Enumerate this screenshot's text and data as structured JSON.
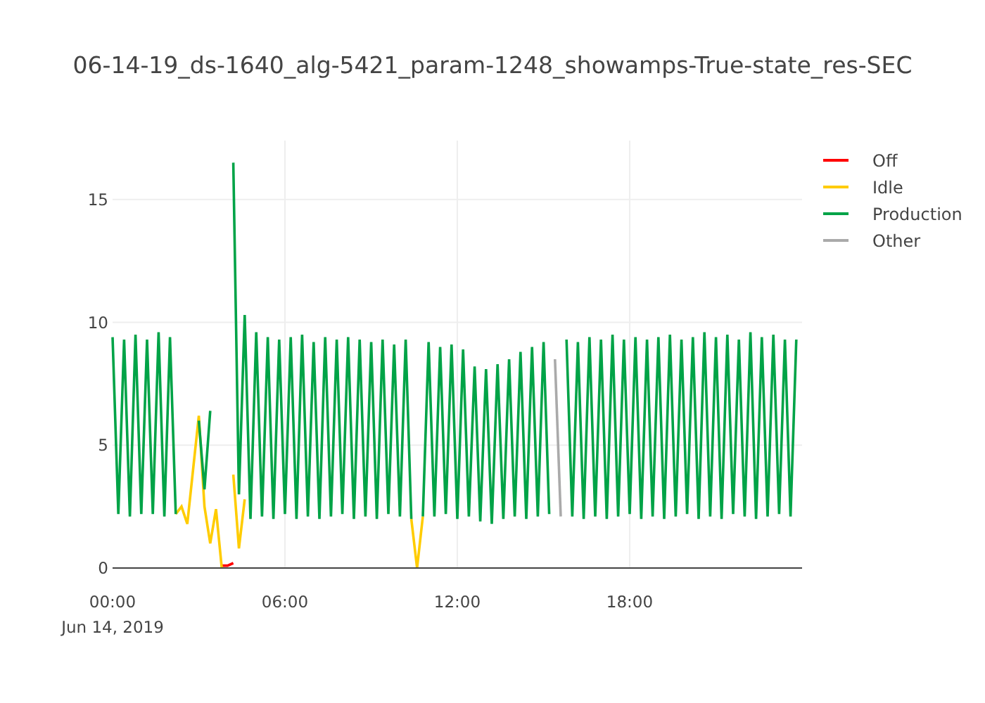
{
  "plot": {
    "title": "06-14-19_ds-1640_alg-5421_param-1248_showamps-True-state_res-SEC",
    "date_label": "Jun 14, 2019",
    "chart_data": {
      "type": "line",
      "grid": true,
      "legend": true,
      "xlim": [
        0,
        24
      ],
      "ylim": [
        0,
        17.4
      ],
      "xticks": [
        {
          "value": 0,
          "label": "00:00"
        },
        {
          "value": 6,
          "label": "06:00"
        },
        {
          "value": 12,
          "label": "12:00"
        },
        {
          "value": 18,
          "label": "18:00"
        }
      ],
      "yticks": [
        0,
        5,
        10,
        15
      ],
      "x": [
        0,
        0.2,
        0.4,
        0.6,
        0.8,
        1.0,
        1.2,
        1.4,
        1.6,
        1.8,
        2.0,
        2.2,
        2.4,
        2.6,
        2.8,
        3.0,
        3.2,
        3.4,
        3.6,
        3.8,
        4.0,
        4.2,
        4.4,
        4.6,
        4.8,
        5.0,
        5.2,
        5.4,
        5.6,
        5.8,
        6.0,
        6.2,
        6.4,
        6.6,
        6.8,
        7.0,
        7.2,
        7.4,
        7.6,
        7.8,
        8.0,
        8.2,
        8.4,
        8.6,
        8.8,
        9.0,
        9.2,
        9.4,
        9.6,
        9.8,
        10.0,
        10.2,
        10.4,
        10.6,
        10.8,
        11.0,
        11.2,
        11.4,
        11.6,
        11.8,
        12.0,
        12.2,
        12.4,
        12.6,
        12.8,
        13.0,
        13.2,
        13.4,
        13.6,
        13.8,
        14.0,
        14.2,
        14.4,
        14.6,
        14.8,
        15.0,
        15.2,
        15.4,
        15.6,
        15.8,
        16.0,
        16.2,
        16.4,
        16.6,
        16.8,
        17.0,
        17.2,
        17.4,
        17.6,
        17.8,
        18.0,
        18.2,
        18.4,
        18.6,
        18.8,
        19.0,
        19.2,
        19.4,
        19.6,
        19.8,
        20.0,
        20.2,
        20.4,
        20.6,
        20.8,
        21.0,
        21.2,
        21.4,
        21.6,
        21.8,
        22.0,
        22.2,
        22.4,
        22.6,
        22.8,
        23.0,
        23.2,
        23.4,
        23.6,
        23.8
      ],
      "series": [
        {
          "name": "Off",
          "color": "#ff0000",
          "values": [
            null,
            null,
            null,
            null,
            null,
            null,
            null,
            null,
            null,
            null,
            null,
            null,
            null,
            null,
            null,
            null,
            null,
            null,
            null,
            0.1,
            0.1,
            0.2,
            null,
            null,
            null,
            null,
            null,
            null,
            null,
            null,
            null,
            null,
            null,
            null,
            null,
            null,
            null,
            null,
            null,
            null,
            null,
            null,
            null,
            null,
            null,
            null,
            null,
            null,
            null,
            null,
            null,
            null,
            null,
            null,
            null,
            null,
            null,
            null,
            null,
            null,
            null,
            null,
            null,
            null,
            null,
            null,
            null,
            null,
            null,
            null,
            null,
            null,
            null,
            null,
            null,
            null,
            null,
            null,
            null,
            null,
            null,
            null,
            null,
            null,
            null,
            null,
            null,
            null,
            null,
            null,
            null,
            null,
            null,
            null,
            null,
            null,
            null,
            null,
            null,
            null,
            null,
            null,
            null,
            null,
            null,
            null,
            null,
            null,
            null,
            null,
            null,
            null,
            null,
            null,
            null,
            null,
            null,
            null,
            null,
            null
          ]
        },
        {
          "name": "Idle",
          "color": "#ffcc00",
          "values": [
            null,
            null,
            null,
            null,
            null,
            null,
            null,
            null,
            null,
            null,
            null,
            2.2,
            2.5,
            1.8,
            4.0,
            6.2,
            2.5,
            1.0,
            2.4,
            0.0,
            null,
            3.8,
            0.8,
            2.8,
            null,
            null,
            null,
            null,
            null,
            null,
            null,
            null,
            null,
            null,
            null,
            null,
            null,
            null,
            null,
            null,
            null,
            null,
            null,
            null,
            null,
            null,
            null,
            null,
            null,
            null,
            null,
            null,
            2.0,
            0.0,
            2.1,
            null,
            null,
            null,
            null,
            null,
            null,
            null,
            null,
            null,
            null,
            null,
            null,
            null,
            null,
            null,
            null,
            null,
            null,
            null,
            null,
            null,
            null,
            null,
            null,
            null,
            null,
            null,
            null,
            null,
            null,
            null,
            null,
            null,
            null,
            null,
            null,
            null,
            null,
            null,
            null,
            null,
            null,
            null,
            null,
            null,
            null,
            null,
            null,
            null,
            null,
            null,
            null,
            null,
            null,
            null,
            null,
            null,
            null,
            null,
            null,
            null,
            null,
            null,
            null,
            null
          ]
        },
        {
          "name": "Production",
          "color": "#00a347",
          "values": [
            9.4,
            2.2,
            9.3,
            2.1,
            9.5,
            2.2,
            9.3,
            2.2,
            9.6,
            2.1,
            9.4,
            2.2,
            null,
            null,
            null,
            6.0,
            3.2,
            6.4,
            null,
            null,
            null,
            16.5,
            3.0,
            10.3,
            2.0,
            9.6,
            2.1,
            9.4,
            2.0,
            9.3,
            2.2,
            9.4,
            2.0,
            9.5,
            2.1,
            9.2,
            2.0,
            9.4,
            2.1,
            9.3,
            2.2,
            9.4,
            2.0,
            9.3,
            2.1,
            9.2,
            2.0,
            9.3,
            2.2,
            9.1,
            2.1,
            9.3,
            2.0,
            null,
            2.1,
            9.2,
            2.1,
            9.0,
            2.2,
            9.1,
            2.0,
            8.9,
            2.1,
            8.2,
            1.9,
            8.1,
            1.8,
            8.3,
            2.0,
            8.5,
            2.1,
            8.8,
            2.0,
            9.0,
            2.1,
            9.2,
            2.2,
            null,
            null,
            9.3,
            2.1,
            9.2,
            2.0,
            9.4,
            2.1,
            9.3,
            2.0,
            9.5,
            2.1,
            9.3,
            2.2,
            9.4,
            2.0,
            9.3,
            2.1,
            9.4,
            2.0,
            9.5,
            2.1,
            9.3,
            2.2,
            9.4,
            2.0,
            9.6,
            2.1,
            9.4,
            2.0,
            9.5,
            2.2,
            9.3,
            2.1,
            9.6,
            2.0,
            9.4,
            2.1,
            9.5,
            2.2,
            9.3,
            2.1,
            9.3
          ]
        },
        {
          "name": "Other",
          "color": "#aaaaaa",
          "values": [
            null,
            null,
            null,
            null,
            null,
            null,
            null,
            null,
            null,
            null,
            null,
            null,
            null,
            null,
            null,
            null,
            null,
            null,
            null,
            null,
            null,
            null,
            null,
            null,
            null,
            null,
            null,
            null,
            null,
            null,
            null,
            null,
            null,
            null,
            null,
            null,
            null,
            null,
            null,
            null,
            null,
            null,
            null,
            null,
            null,
            null,
            null,
            null,
            null,
            null,
            null,
            null,
            null,
            null,
            null,
            null,
            null,
            null,
            null,
            null,
            null,
            null,
            null,
            null,
            null,
            null,
            null,
            null,
            null,
            null,
            null,
            null,
            null,
            null,
            null,
            null,
            null,
            8.5,
            2.1,
            null,
            null,
            null,
            null,
            null,
            null,
            null,
            null,
            null,
            null,
            null,
            null,
            null,
            null,
            null,
            null,
            null,
            null,
            null,
            null,
            null,
            null,
            null,
            null,
            null,
            null,
            null,
            null,
            null,
            null,
            null,
            null,
            null,
            null,
            null,
            null,
            null,
            null,
            null,
            null,
            null
          ]
        }
      ]
    }
  }
}
